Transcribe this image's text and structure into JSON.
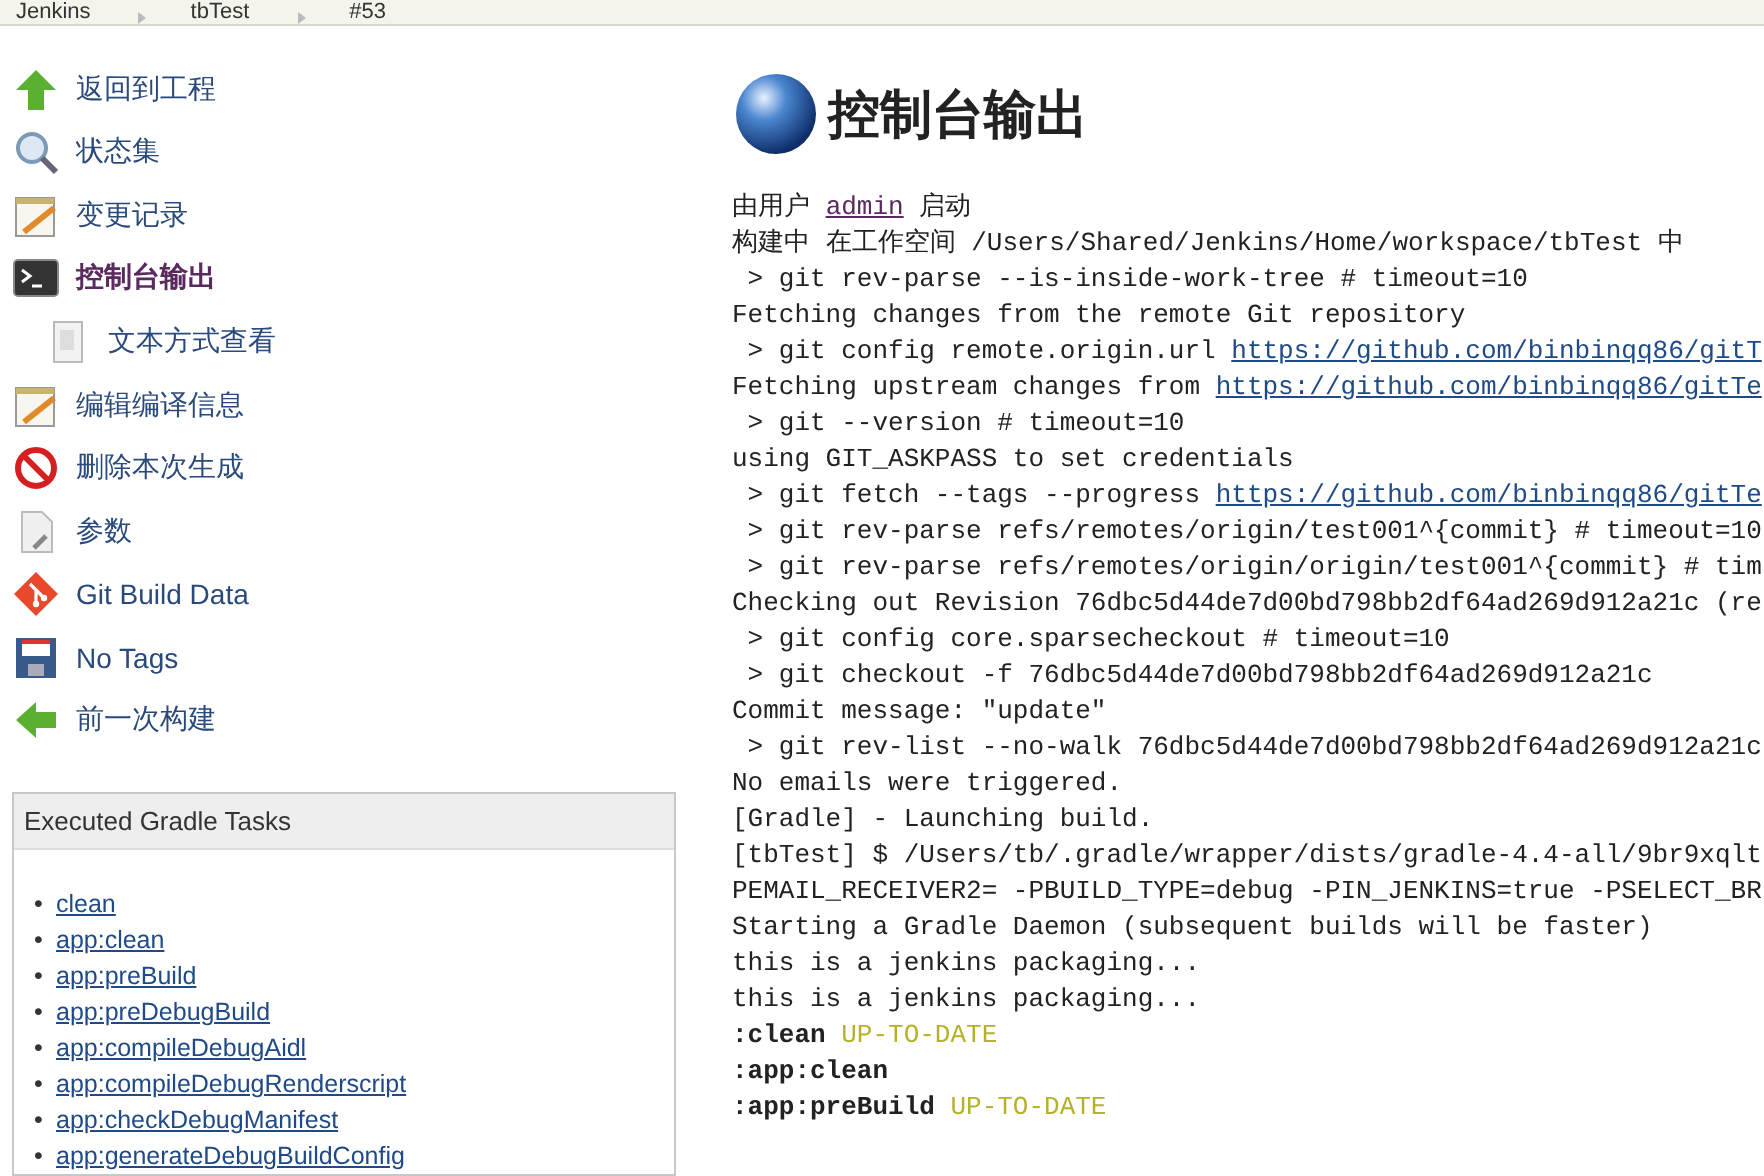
{
  "breadcrumbs": [
    "Jenkins",
    "tbTest",
    "#53"
  ],
  "sidebar": {
    "items": [
      {
        "label": "返回到工程",
        "selected": false
      },
      {
        "label": "状态集",
        "selected": false
      },
      {
        "label": "变更记录",
        "selected": false
      },
      {
        "label": "控制台输出",
        "selected": true,
        "children": [
          {
            "label": "文本方式查看",
            "selected": false
          }
        ]
      },
      {
        "label": "编辑编译信息",
        "selected": false
      },
      {
        "label": "删除本次生成",
        "selected": false
      },
      {
        "label": "参数",
        "selected": false
      },
      {
        "label": "Git Build Data",
        "selected": false
      },
      {
        "label": "No Tags",
        "selected": false
      },
      {
        "label": "前一次构建",
        "selected": false
      }
    ]
  },
  "gradle_tasks": {
    "title": "Executed Gradle Tasks",
    "items": [
      {
        "bullet": "•",
        "label": "clean"
      },
      {
        "bullet": "•",
        "label": "app:clean"
      },
      {
        "bullet": "•",
        "label": "app:preBuild"
      },
      {
        "bullet": "•",
        "label": "app:preDebugBuild"
      },
      {
        "bullet": "•",
        "label": "app:compileDebugAidl"
      },
      {
        "bullet": "•",
        "label": "app:compileDebugRenderscript"
      },
      {
        "bullet": "•",
        "label": "app:checkDebugManifest"
      },
      {
        "bullet": "•",
        "label": "app:generateDebugBuildConfig"
      }
    ]
  },
  "main": {
    "title": "控制台输出",
    "console": [
      [
        {
          "kind": "text",
          "text": "由用户 "
        },
        {
          "kind": "user",
          "text": "admin"
        },
        {
          "kind": "text",
          "text": " 启动"
        }
      ],
      [
        {
          "kind": "text",
          "text": "构建中 在工作空间 /Users/Shared/Jenkins/Home/workspace/tbTest 中"
        }
      ],
      [
        {
          "kind": "text",
          "text": " > git rev-parse --is-inside-work-tree # timeout=10"
        }
      ],
      [
        {
          "kind": "text",
          "text": "Fetching changes from the remote Git repository"
        }
      ],
      [
        {
          "kind": "text",
          "text": " > git config remote.origin.url "
        },
        {
          "kind": "link",
          "text": "https://github.com/binbinqq86/gitT"
        }
      ],
      [
        {
          "kind": "text",
          "text": "Fetching upstream changes from "
        },
        {
          "kind": "link",
          "text": "https://github.com/binbinqq86/gitTe"
        }
      ],
      [
        {
          "kind": "text",
          "text": " > git --version # timeout=10"
        }
      ],
      [
        {
          "kind": "text",
          "text": "using GIT_ASKPASS to set credentials"
        }
      ],
      [
        {
          "kind": "text",
          "text": " > git fetch --tags --progress "
        },
        {
          "kind": "link",
          "text": "https://github.com/binbinqq86/gitTe"
        }
      ],
      [
        {
          "kind": "text",
          "text": " > git rev-parse refs/remotes/origin/test001^{commit} # timeout=10"
        }
      ],
      [
        {
          "kind": "text",
          "text": " > git rev-parse refs/remotes/origin/origin/test001^{commit} # tim"
        }
      ],
      [
        {
          "kind": "text",
          "text": "Checking out Revision 76dbc5d44de7d00bd798bb2df64ad269d912a21c (re"
        }
      ],
      [
        {
          "kind": "text",
          "text": " > git config core.sparsecheckout # timeout=10"
        }
      ],
      [
        {
          "kind": "text",
          "text": " > git checkout -f 76dbc5d44de7d00bd798bb2df64ad269d912a21c"
        }
      ],
      [
        {
          "kind": "text",
          "text": "Commit message: \"update\""
        }
      ],
      [
        {
          "kind": "text",
          "text": " > git rev-list --no-walk 76dbc5d44de7d00bd798bb2df64ad269d912a21c"
        }
      ],
      [
        {
          "kind": "text",
          "text": "No emails were triggered."
        }
      ],
      [
        {
          "kind": "text",
          "text": "[Gradle] - Launching build."
        }
      ],
      [
        {
          "kind": "text",
          "text": "[tbTest] $ /Users/tb/.gradle/wrapper/dists/gradle-4.4-all/9br9xqlt"
        }
      ],
      [
        {
          "kind": "text",
          "text": "PEMAIL_RECEIVER2= -PBUILD_TYPE=debug -PIN_JENKINS=true -PSELECT_BR"
        }
      ],
      [
        {
          "kind": "text",
          "text": "Starting a Gradle Daemon (subsequent builds will be faster)"
        }
      ],
      [
        {
          "kind": "text",
          "text": "this is a jenkins packaging..."
        }
      ],
      [
        {
          "kind": "text",
          "text": "this is a jenkins packaging..."
        }
      ],
      [
        {
          "kind": "task",
          "text": ":clean"
        },
        {
          "kind": "status",
          "text": "UP-TO-DATE"
        }
      ],
      [
        {
          "kind": "task",
          "text": ":app:clean"
        }
      ],
      [
        {
          "kind": "task",
          "text": ":app:preBuild"
        },
        {
          "kind": "status",
          "text": "UP-TO-DATE"
        }
      ]
    ]
  }
}
